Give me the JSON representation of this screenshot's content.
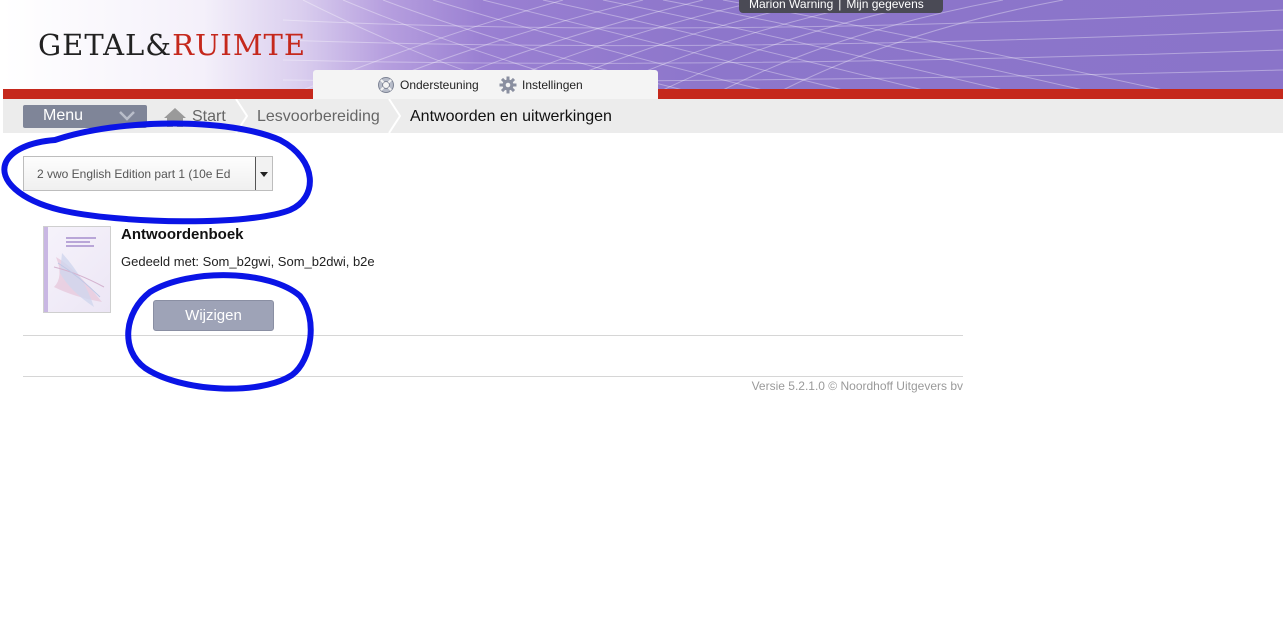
{
  "header": {
    "logo_part1": "GETAL&",
    "logo_part2": "RUIMTE",
    "user_name": "Marion Warning",
    "user_separator": "|",
    "account_link": "Mijn gegevens",
    "tools": {
      "support_label": "Ondersteuning",
      "settings_label": "Instellingen"
    }
  },
  "breadcrumb": {
    "menu_label": "Menu",
    "items": [
      "Start",
      "Lesvoorbereiding",
      "Antwoorden en uitwerkingen"
    ]
  },
  "method_select": {
    "selected_value": "2 vwo English Edition part 1 (10e Ed"
  },
  "book": {
    "title": "Antwoordenboek",
    "shared_with": "Gedeeld met: Som_b2gwi, Som_b2dwi, b2e",
    "edit_label": "Wijzigen"
  },
  "footer": {
    "version": "Versie 5.2.1.0 © Noordhoff Uitgevers bv"
  },
  "colors": {
    "brand_red": "#c5281c",
    "header_purple": "#8a74c9",
    "annotation_blue": "#0a14e6"
  }
}
